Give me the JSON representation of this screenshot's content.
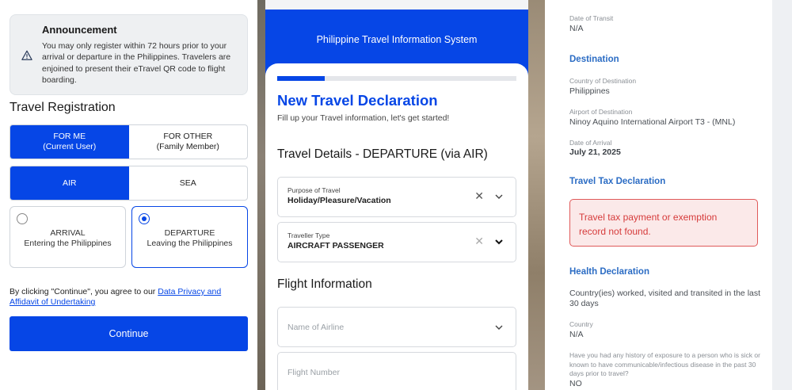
{
  "panel1": {
    "announcement": {
      "title": "Announcement",
      "text": "You may only register within 72 hours prior to your arrival or departure in the Philippines. Travelers are enjoined to present their eTravel QR code to flight boarding.",
      "icon": "warning-icon"
    },
    "heading": "Travel Registration",
    "registrant": {
      "for_me_line1": "FOR ME",
      "for_me_line2": "(Current User)",
      "for_other_line1": "FOR OTHER",
      "for_other_line2": "(Family Member)",
      "selected": "FOR ME"
    },
    "mode": {
      "air": "AIR",
      "sea": "SEA",
      "selected": "AIR"
    },
    "direction": {
      "arrival_title": "ARRIVAL",
      "arrival_sub": "Entering the Philippines",
      "departure_title": "DEPARTURE",
      "departure_sub": "Leaving the Philippines",
      "selected": "DEPARTURE"
    },
    "consent_prefix": "By clicking \"Continue\", you agree to our ",
    "consent_link": "Data Privacy and Affidavit of Undertaking",
    "continue_label": "Continue",
    "accent_color": "#0646e6"
  },
  "panel2": {
    "header_title": "Philippine Travel Information System",
    "progress_fraction": 0.2,
    "title": "New Travel Declaration",
    "subtitle": "Fill up your Travel information, let's get started!",
    "section1": "Travel Details - DEPARTURE (via AIR)",
    "purpose": {
      "label": "Purpose of Travel",
      "value": "Holiday/Pleasure/Vacation"
    },
    "traveller_type": {
      "label": "Traveller Type",
      "value": "AIRCRAFT PASSENGER"
    },
    "section2": "Flight Information",
    "airline_placeholder": "Name of Airline",
    "flight_placeholder": "Flight Number"
  },
  "panel3": {
    "transit_date_label": "Date of Transit",
    "transit_date_value": "N/A",
    "destination_heading": "Destination",
    "country_dest_label": "Country of Destination",
    "country_dest_value": "Philippines",
    "airport_dest_label": "Airport of Destination",
    "airport_dest_value": "Ninoy Aquino International Airport T3 - (MNL)",
    "arrival_date_label": "Date of Arrival",
    "arrival_date_value": "July 21, 2025",
    "tax_heading": "Travel Tax Declaration",
    "tax_message": "Travel tax payment or exemption record not found.",
    "health_heading": "Health Declaration",
    "health_countries_text": "Country(ies) worked, visited and transited in the last 30 days",
    "country_label": "Country",
    "country_value": "N/A",
    "exposure_question": "Have you had any history of exposure to a person who is sick or known to have communicable/infectious disease in the past 30 days prior to travel?",
    "exposure_answer": "NO",
    "heading_color": "#2b6cc4",
    "error_color": "#d63b3b"
  }
}
